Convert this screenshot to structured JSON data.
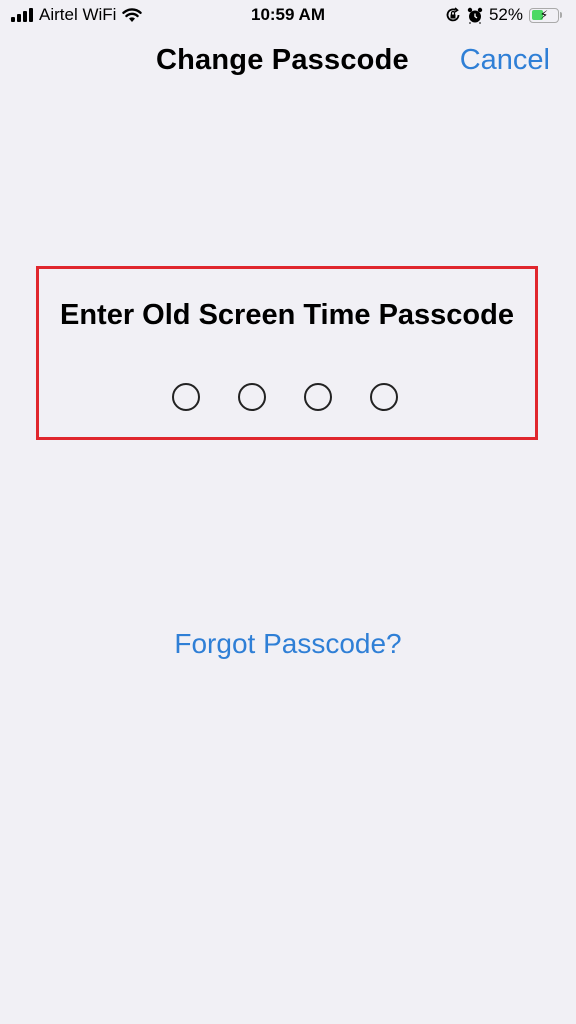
{
  "status_bar": {
    "carrier": "Airtel WiFi",
    "time": "10:59 AM",
    "battery_percent": "52%",
    "battery_level": 0.52,
    "icons": [
      "signal-icon",
      "wifi-icon",
      "orientation-lock-icon",
      "alarm-icon",
      "battery-charging-icon"
    ]
  },
  "nav": {
    "title": "Change Passcode",
    "cancel_label": "Cancel"
  },
  "prompt": {
    "title": "Enter Old Screen Time Passcode",
    "digits_total": 4,
    "digits_entered": 0
  },
  "forgot_label": "Forgot Passcode?",
  "colors": {
    "accent": "#2f7fd6",
    "background": "#f1f0f5",
    "highlight_border": "#e0262d",
    "battery": "#4cd964"
  }
}
